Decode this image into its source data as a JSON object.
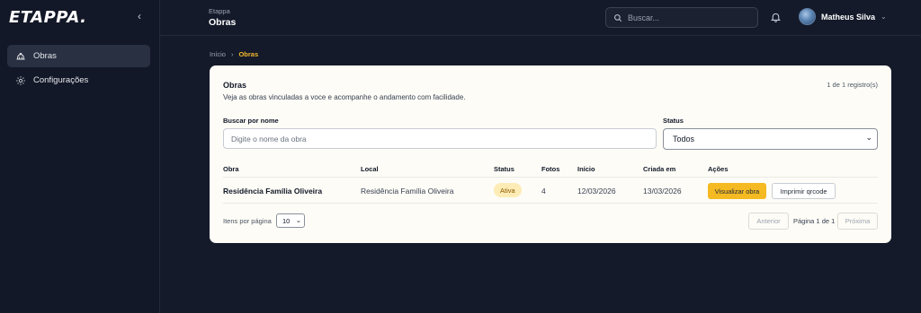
{
  "app": {
    "logo": "ETAPPA."
  },
  "sidebar": {
    "items": [
      {
        "label": "Obras",
        "icon": "helmet-icon",
        "active": true
      },
      {
        "label": "Configurações",
        "icon": "gear-icon",
        "active": false
      }
    ]
  },
  "header": {
    "subtitle": "Etappa",
    "title": "Obras",
    "search_placeholder": "Buscar...",
    "user_name": "Matheus Silva"
  },
  "breadcrumb": {
    "home": "Início",
    "current": "Obras"
  },
  "card": {
    "title": "Obras",
    "description": "Veja as obras vinculadas a voce e acompanhe o andamento com facilidade.",
    "count": "1 de 1 registro(s)",
    "filters": {
      "name_label": "Buscar por nome",
      "name_placeholder": "Digite o nome da obra",
      "status_label": "Status",
      "status_value": "Todos"
    },
    "table": {
      "headers": [
        "Obra",
        "Local",
        "Status",
        "Fotos",
        "Início",
        "Criada em",
        "Ações"
      ],
      "rows": [
        {
          "obra": "Residência Família Oliveira",
          "local": "Residência Família Oliveira",
          "status": "Ativa",
          "fotos": "4",
          "inicio": "12/03/2026",
          "criada": "13/03/2026",
          "view_label": "Visualizar obra",
          "print_label": "Imprimir qrcode"
        }
      ]
    },
    "pagination": {
      "per_page_label": "Itens por página",
      "per_page_value": "10",
      "prev_label": "Anterior",
      "page_info": "Página 1 de 1",
      "next_label": "Próxima"
    }
  },
  "colors": {
    "background": "#141a2a",
    "accent": "#f5b921",
    "card": "#fdfcf6",
    "badge_bg": "#fdecb5"
  }
}
